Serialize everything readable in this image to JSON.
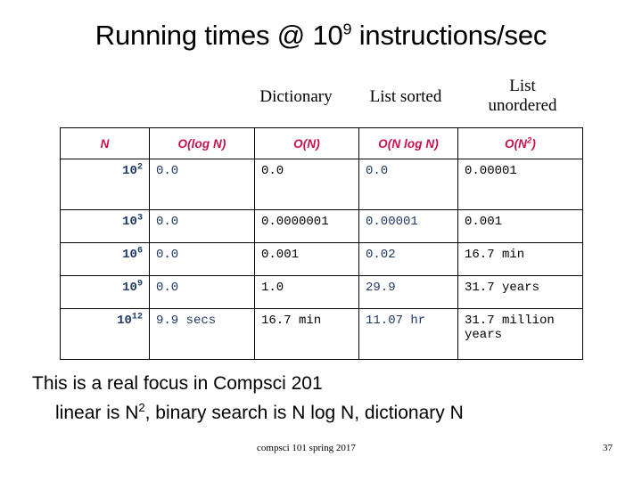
{
  "slide": {
    "title_prefix": "Running times @ 10",
    "title_exponent": "9",
    "title_suffix": " instructions/sec",
    "accent_header_color": "#C8104B",
    "navy_color": "#1F3864"
  },
  "captions": {
    "dictionary": "Dictionary",
    "list_sorted": "List sorted",
    "list_unordered_line1": "List",
    "list_unordered_line2": "unordered"
  },
  "table": {
    "headers": {
      "n": "N",
      "logn": "O(log N)",
      "n1": "O(N)",
      "nlogn": "O(N log N)",
      "n2_prefix": "O(N",
      "n2_exponent": "2",
      "n2_suffix": ")"
    },
    "rows": [
      {
        "n_base": "10",
        "n_exp": "2",
        "logn": "0.0",
        "n1": "0.0",
        "nlogn": "0.0",
        "n2": "0.00001"
      },
      {
        "n_base": "10",
        "n_exp": "3",
        "logn": "0.0",
        "n1": "0.0000001",
        "nlogn": "0.00001",
        "n2": "0.001"
      },
      {
        "n_base": "10",
        "n_exp": "6",
        "logn": "0.0",
        "n1": "0.001",
        "nlogn": "0.02",
        "n2": "16.7 min"
      },
      {
        "n_base": "10",
        "n_exp": "9",
        "logn": "0.0",
        "n1": "1.0",
        "nlogn": "29.9",
        "n2": "31.7 years"
      },
      {
        "n_base": "10",
        "n_exp": "12",
        "logn": "9.9 secs",
        "n1": "16.7 min",
        "nlogn": "11.07 hr",
        "n2": "31.7 million years"
      }
    ]
  },
  "body": {
    "line1": "This is a real focus in Compsci 201",
    "line2_prefix": "linear is N",
    "line2_exponent": "2",
    "line2_suffix": ", binary search is N log N, dictionary N"
  },
  "footer": {
    "course": "compsci 101 spring 2017",
    "page_number": "37"
  }
}
